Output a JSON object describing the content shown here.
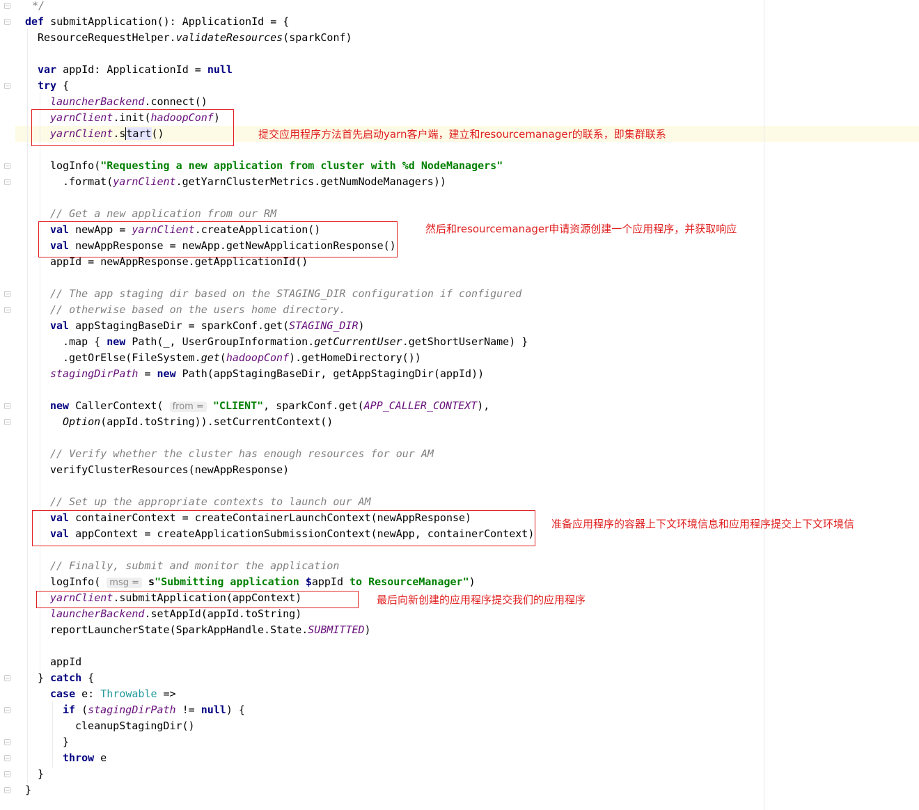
{
  "code": {
    "l0": "*/",
    "l1_def": "def",
    "l1_rest": " submitApplication(): ApplicationId = {",
    "l2": "ResourceRequestHelper.",
    "l2_it": "validateResources",
    "l2_end": "(sparkConf)",
    "l4_var": "var",
    "l4_mid": " appId: ApplicationId = ",
    "l4_null": "null",
    "l5_try": "try",
    "l5_end": " {",
    "l6_fld": "launcherBackend",
    "l6_end": ".connect()",
    "l7_fld": "yarnClient",
    "l7_mid": ".init(",
    "l7_arg": "hadoopConf",
    "l7_end": ")",
    "l8_fld": "yarnClient",
    "l8_a": ".s",
    "l8_b": "tart",
    "l8_end": "()",
    "l10_a": "logInfo(",
    "l10_str": "\"Requesting a new application from cluster with %d NodeManagers\"",
    "l11_a": ".format(",
    "l11_fld": "yarnClient",
    "l11_end": ".getYarnClusterMetrics.getNumNodeManagers))",
    "l13_cm": "// Get a new application from our RM",
    "l14_val": "val",
    "l14_mid": " newApp = ",
    "l14_fld": "yarnClient",
    "l14_end": ".createApplication()",
    "l15_val": "val",
    "l15_end": " newAppResponse = newApp.getNewApplicationResponse()",
    "l16": "appId = newAppResponse.getApplicationId()",
    "l18_cm": "// The app staging dir based on the STAGING_DIR configuration if configured",
    "l19_cm": "// otherwise based on the users home directory.",
    "l20_val": "val",
    "l20_mid": " appStagingBaseDir = sparkConf.get(",
    "l20_it": "STAGING_DIR",
    "l20_end": ")",
    "l21_a": ".map { ",
    "l21_new": "new",
    "l21_b": " Path(_, UserGroupInformation.",
    "l21_it": "getCurrentUser",
    "l21_end": ".getShortUserName) }",
    "l22_a": ".getOrElse(FileSystem.",
    "l22_it": "get",
    "l22_b": "(",
    "l22_fld": "hadoopConf",
    "l22_end": ").getHomeDirectory())",
    "l23_fld": "stagingDirPath",
    "l23_mid": " = ",
    "l23_new": "new",
    "l23_end": " Path(appStagingBaseDir, getAppStagingDir(appId))",
    "l25_new": "new",
    "l25_a": " CallerContext( ",
    "l25_hint": "from =",
    "l25_str": " \"CLIENT\"",
    "l25_b": ", sparkConf.get(",
    "l25_it": "APP_CALLER_CONTEXT",
    "l25_end": "),",
    "l26_it": "Option",
    "l26_end": "(appId.toString)).setCurrentContext()",
    "l28_cm": "// Verify whether the cluster has enough resources for our AM",
    "l29": "verifyClusterResources(newAppResponse)",
    "l31_cm": "// Set up the appropriate contexts to launch our AM",
    "l32_val": "val",
    "l32_end": " containerContext = createContainerLaunchContext(newAppResponse)",
    "l33_val": "val",
    "l33_end": " appContext = createApplicationSubmissionContext(newApp, containerContext)",
    "l35_cm": "// Finally, submit and monitor the application",
    "l36_a": "logInfo( ",
    "l36_hint": "msg =",
    "l36_s": " s",
    "l36_str1": "\"Submitting application ",
    "l36_dollar": "$",
    "l36_var": "appId",
    "l36_str2": " to ResourceManager\"",
    "l36_end": ")",
    "l37_fld": "yarnClient",
    "l37_end": ".submitApplication(appContext)",
    "l38_fld": "launcherBackend",
    "l38_end": ".setAppId(appId.toString)",
    "l39_a": "reportLauncherState(SparkAppHandle.State.",
    "l39_it": "SUBMITTED",
    "l39_end": ")",
    "l41": "appId",
    "l42_a": "} ",
    "l42_catch": "catch",
    "l42_end": " {",
    "l43_case": "case",
    "l43_a": " e: ",
    "l43_typ": "Throwable",
    "l43_end": " =>",
    "l44_if": "if",
    "l44_a": " (",
    "l44_fld": "stagingDirPath",
    "l44_b": " != ",
    "l44_null": "null",
    "l44_end": ") {",
    "l45": "cleanupStagingDir()",
    "l46": "}",
    "l47_throw": "throw",
    "l47_end": " e",
    "l48": "}",
    "l49": "}"
  },
  "annotations": {
    "note1": "提交应用程序方法首先启动yarn客户端，建立和resourcemanager的联系，即集群联系",
    "note2": "然后和resourcemanager申请资源创建一个应用程序，并获取响应",
    "note3": "准备应用程序的容器上下文环境信息和应用程序提交上下文环境信",
    "note4": "最后向新创建的应用程序提交我们的应用程序"
  },
  "colors": {
    "annotation": "#e02020",
    "keyword": "#000080",
    "string": "#008000",
    "field": "#660e7a",
    "comment": "#808080",
    "caret_line": "#fdfbe6"
  }
}
